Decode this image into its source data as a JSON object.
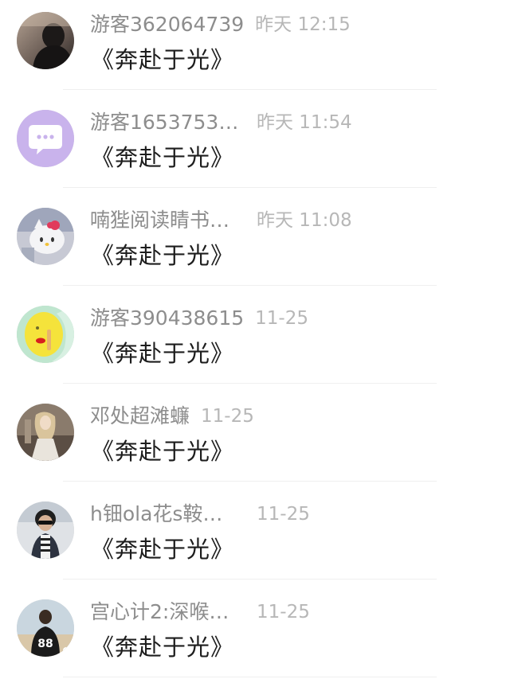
{
  "comments": [
    {
      "user": "游客362064739",
      "time": "昨天 12:15",
      "title": "《奔赴于光》",
      "avatar": "dark-silhouette-avatar"
    },
    {
      "user": "游客1653753…",
      "time": "昨天 11:54",
      "title": "《奔赴于光》",
      "avatar": "chat-bubble-avatar"
    },
    {
      "user": "喃狴阅读睛书…",
      "time": "昨天 11:08",
      "title": "《奔赴于光》",
      "avatar": "hello-kitty-avatar"
    },
    {
      "user": "游客390438615",
      "time": "11-25",
      "title": "《奔赴于光》",
      "avatar": "yellow-face-avatar"
    },
    {
      "user": "邓处超滩蠊",
      "time": "11-25",
      "title": "《奔赴于光》",
      "avatar": "girl-photo-avatar"
    },
    {
      "user": "h钿ola花s鞍…",
      "time": "11-25",
      "title": "《奔赴于光》",
      "avatar": "man-sunglasses-avatar"
    },
    {
      "user": "宫心计2:深喉…",
      "time": "11-25",
      "title": "《奔赴于光》",
      "avatar": "soccer-jersey-avatar"
    }
  ]
}
